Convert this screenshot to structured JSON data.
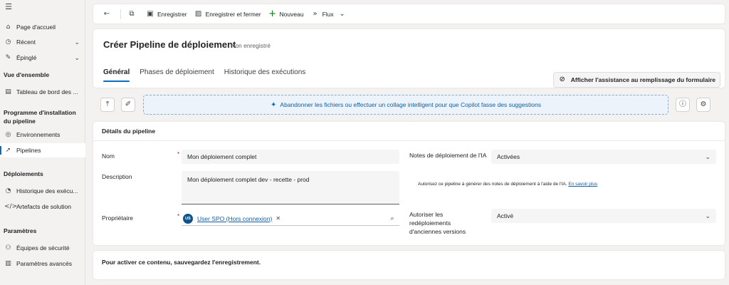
{
  "sidebar": {
    "items": [
      {
        "label": "Page d'accueil",
        "icon": "home-icon"
      },
      {
        "label": "Récent",
        "icon": "clock-icon"
      },
      {
        "label": "Épinglé",
        "icon": "pin-icon"
      }
    ],
    "section_overview": "Vue d'ensemble",
    "overview_items": [
      {
        "label": "Tableau de bord des ...",
        "icon": "dashboard-icon"
      }
    ],
    "section_install": "Programme d'installation du pipeline",
    "install_items": [
      {
        "label": "Environnements",
        "icon": "globe-icon"
      },
      {
        "label": "Pipelines",
        "icon": "rocket-icon"
      }
    ],
    "section_deploy": "Déploiements",
    "deploy_items": [
      {
        "label": "Historique des exécu...",
        "icon": "history-icon"
      },
      {
        "label": "Artefacts de solution",
        "icon": "code-icon"
      }
    ],
    "section_params": "Paramètres",
    "params_items": [
      {
        "label": "Équipes de sécurité",
        "icon": "team-icon"
      },
      {
        "label": "Paramètres avancés",
        "icon": "settings-icon"
      }
    ]
  },
  "toolbar": {
    "save": "Enregistrer",
    "save_close": "Enregistrer et fermer",
    "new": "Nouveau",
    "flow": "Flux"
  },
  "header": {
    "title": "Créer Pipeline de déploiement",
    "subtitle": "- Non enregistré",
    "tabs": [
      "Général",
      "Phases de déploiement",
      "Historique des exécutions"
    ],
    "assist_button": "Afficher l'assistance au remplissage du formulaire"
  },
  "dropzone": {
    "text": "Abandonner les fichiers ou effectuer un collage intelligent pour que Copilot fasse des suggestions"
  },
  "details": {
    "section_title": "Détails du pipeline",
    "name_label": "Nom",
    "name_value": "Mon déploiement complet",
    "description_label": "Description",
    "description_value": "Mon déploiement complet dev - recette - prod",
    "owner_label": "Propriétaire",
    "owner_initials": "US",
    "owner_value": "User SPO (Hors connexion)",
    "ai_notes_label": "Notes de déploiement de l'IA",
    "ai_notes_value": "Activées",
    "ai_hint": "Autorisez ce pipeline à générer des notes de déploiement à l'aide de l'IA.",
    "ai_hint_link": "En savoir plus",
    "redeploy_label": "Autoriser les redéploiements d'anciennes versions",
    "redeploy_value": "Activé"
  },
  "bottom": {
    "text": "Pour activer ce contenu, sauvegardez l'enregistrement."
  },
  "colors": {
    "accent": "#0f6cbd",
    "link": "#115ea3",
    "required": "#a4262c"
  }
}
